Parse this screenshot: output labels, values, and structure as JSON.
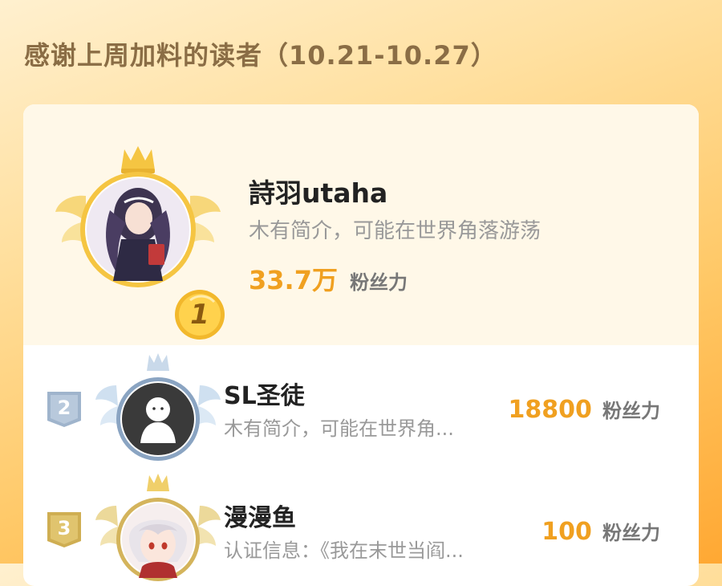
{
  "header": {
    "title": "感谢上周加料的读者（10.21-10.27）"
  },
  "ranking": [
    {
      "rank": "1",
      "name": "詩羽utaha",
      "intro": "木有简介，可能在世界角落游荡",
      "fans_value": "33.7万",
      "fans_unit": "粉丝力"
    },
    {
      "rank": "2",
      "name": "SL圣徒",
      "intro": "木有简介，可能在世界角...",
      "fans_value": "18800",
      "fans_unit": "粉丝力"
    },
    {
      "rank": "3",
      "name": "漫漫鱼",
      "intro": "认证信息：《我在末世当阎...",
      "fans_value": "100",
      "fans_unit": "粉丝力"
    }
  ],
  "colors": {
    "accent": "#f0a020",
    "gold": "#f5c542",
    "silver": "#9fb4cc",
    "bronze": "#d4b45c"
  }
}
